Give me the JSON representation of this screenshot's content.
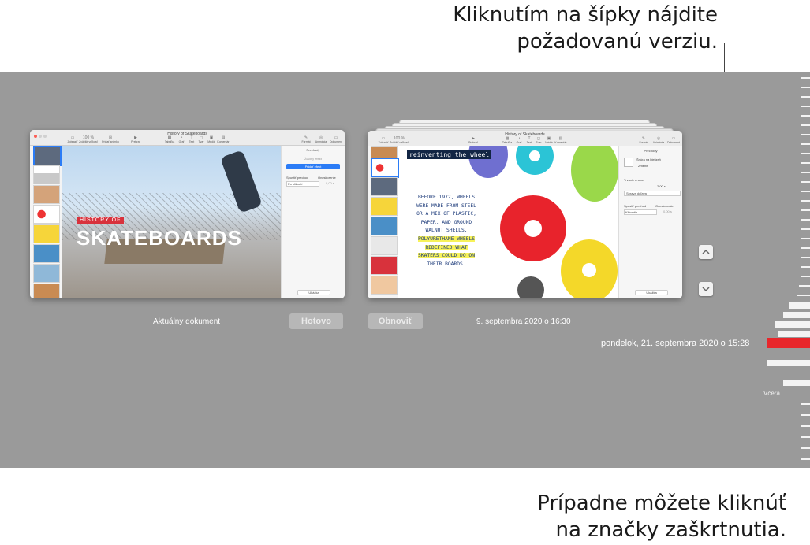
{
  "callouts": {
    "top_line1": "Kliknutím na šípky nájdite",
    "top_line2": "požadovanú verziu.",
    "bottom_line1": "Prípadne môžete kliknúť",
    "bottom_line2": "na značky zaškrtnutia."
  },
  "current_window": {
    "title": "History of Skateboards",
    "toolbar": [
      "Zobraziť",
      "Zväčšiť veľkosť",
      "Pridať snímku",
      "Prehrať",
      "Tabuľka",
      "Graf",
      "Text",
      "Tvar",
      "Médiá",
      "Komentár",
      "Formát",
      "Animácia",
      "Dokument"
    ],
    "zoom": "100 %",
    "slide_overlay_small": "HISTORY OF",
    "slide_overlay_big": "SKATEBOARDS",
    "panel_header": "Prechody",
    "panel_effect": "Žiadny efekt",
    "panel_add_button": "Pridať efekt",
    "panel_start_label": "Spustiť prechod",
    "panel_start_value": "Po kliknutí",
    "panel_delay_label": "Oneskorenie",
    "panel_delay_value": "0,00 s",
    "panel_preview": "Ukážka"
  },
  "version_window": {
    "title": "History of Skateboards",
    "zoom": "100 %",
    "slide_heading": "reinventing the wheel",
    "slide_text": [
      "BEFORE 1972, WHEELS",
      "WERE MADE FROM STEEL",
      "OR A MIX OF PLASTIC,",
      "PAPER, AND GROUND",
      "WALNUT SHELLS.",
      "POLYURETHANE WHEELS",
      "REDEFINED WHAT",
      "SKATERS COULD DO ON",
      "THEIR BOARDS."
    ],
    "panel_header": "Prechody",
    "panel_effect": "Šnúra na bielizeň",
    "panel_change": "Zmeniť",
    "panel_direction": "Sprava doľava",
    "panel_duration_label": "Trvanie a smer",
    "panel_duration_value": "2,00 s",
    "panel_start_label": "Spustiť prechod",
    "panel_start_value": "Kliknutie",
    "panel_delay_label": "Oneskorenie",
    "panel_delay_value": "0,00 s",
    "panel_preview": "Ukážka"
  },
  "bottom_bar": {
    "current_label": "Aktuálny dokument",
    "done_button": "Hotovo",
    "restore_button": "Obnoviť",
    "version_date": "9. septembra 2020 o 16:30"
  },
  "timeline": {
    "selected_label": "pondelok, 21. septembra 2020 o 15:28",
    "yesterday_label": "Včera",
    "accent_color": "#e8262b"
  }
}
